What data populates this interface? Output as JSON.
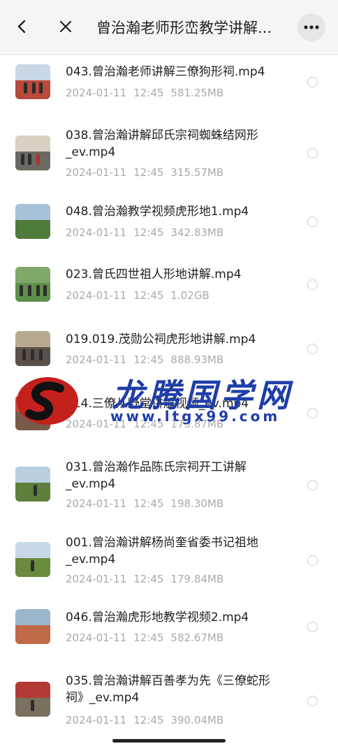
{
  "header": {
    "title": "曾治瀚老师形峦教学讲解...",
    "back_icon": "chevron-left-icon",
    "close_icon": "close-icon",
    "more_icon": "more-dots-icon"
  },
  "files": [
    {
      "name": "043.曾治瀚老师讲解三僚狗形祠.mp4",
      "date": "2024-01-11",
      "time": "12:45",
      "size": "581.25MB"
    },
    {
      "name": "038.曾治瀚讲解邱氏宗祠蜘蛛结网形_ev.mp4",
      "date": "2024-01-11",
      "time": "12:45",
      "size": "315.57MB"
    },
    {
      "name": "048.曾治瀚教学视频虎形地1.mp4",
      "date": "2024-01-11",
      "time": "12:45",
      "size": "342.83MB"
    },
    {
      "name": "023.曾氏四世祖人形地讲解.mp4",
      "date": "2024-01-11",
      "time": "12:45",
      "size": "1.02GB"
    },
    {
      "name": "019.019.茂勋公祠虎形地讲解.mp4",
      "date": "2024-01-11",
      "time": "12:45",
      "size": "888.93MB"
    },
    {
      "name": "014.三僚从野堂讲解视频_ev.mp4",
      "date": "2024-01-11",
      "time": "12:45",
      "size": "173.87MB"
    },
    {
      "name": "031.曾治瀚作品陈氏宗祠开工讲解_ev.mp4",
      "date": "2024-01-11",
      "time": "12:45",
      "size": "198.30MB"
    },
    {
      "name": "001.曾治瀚讲解杨尚奎省委书记祖地_ev.mp4",
      "date": "2024-01-11",
      "time": "12:45",
      "size": "179.84MB"
    },
    {
      "name": "046.曾治瀚虎形地教学视频2.mp4",
      "date": "2024-01-11",
      "time": "12:45",
      "size": "582.67MB"
    },
    {
      "name": "035.曾治瀚讲解百善孝为先《三僚蛇形祠》_ev.mp4",
      "date": "2024-01-11",
      "time": "12:45",
      "size": "390.04MB"
    }
  ],
  "watermark": {
    "text": "龙腾国学网",
    "url": "www.ltgx99.com"
  }
}
